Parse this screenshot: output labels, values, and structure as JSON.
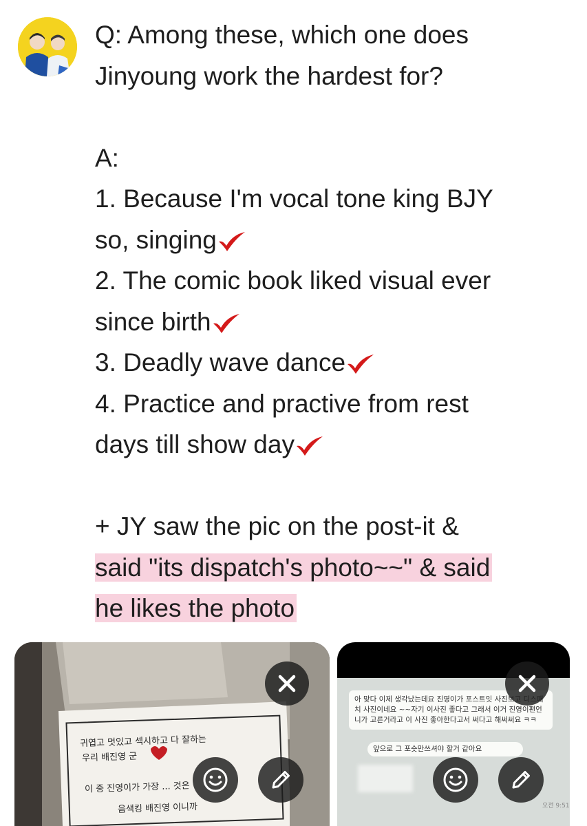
{
  "post": {
    "question_line1": "Q: Among these, which one does",
    "question_line2": "Jinyoung work the hardest for?",
    "answer_label": "A:",
    "item1_line1": "1. Because I'm vocal tone king BJY",
    "item1_line2": "so, singing",
    "item2_line1": "2. The comic book liked visual ever",
    "item2_line2": "since birth",
    "item3_line1": "3. Deadly wave dance",
    "item4_line1": "4. Practice and practive from rest",
    "item4_line2": "days till show day",
    "note_line1": "+ JY saw the pic on the post-it &",
    "note_line2": "said \"its dispatch's photo~~\" & said",
    "note_line3": "he likes the photo"
  },
  "attachments": [
    {
      "kind": "photo-postit",
      "card_line1": "귀엽고 멋있고 섹시하고 다 잘하는",
      "card_line2": "우리 배진영 군",
      "card_line3": "이 중 진영이가 가장 ... 것은",
      "card_line4": "음색킹 배진영 이니까"
    },
    {
      "kind": "chat-screenshot",
      "chat_message": "아 맞다 이제 생각났는데요 진영이가 포스트잇 사진보고 디스패치 사진이네요 ~~자기 이사진 좋다고 그래서 이거 진영이팬언니가 고른거라고 이 사진 좋아한다고서 써다고 해써써요 ㅋㅋ",
      "chat_reply": "앞으로 그 포슷만쓰셔야 할거 같아요",
      "chat_time": "오전 9:51"
    }
  ],
  "icons": {
    "check": "red-checkmark-icon",
    "close": "close-icon",
    "emoji": "smiley-icon",
    "edit": "pencil-icon"
  },
  "colors": {
    "highlight": "#f8d2de",
    "check": "#d41a1a",
    "text": "#1e1e1e",
    "avatar_bg": "#f4d31f"
  }
}
